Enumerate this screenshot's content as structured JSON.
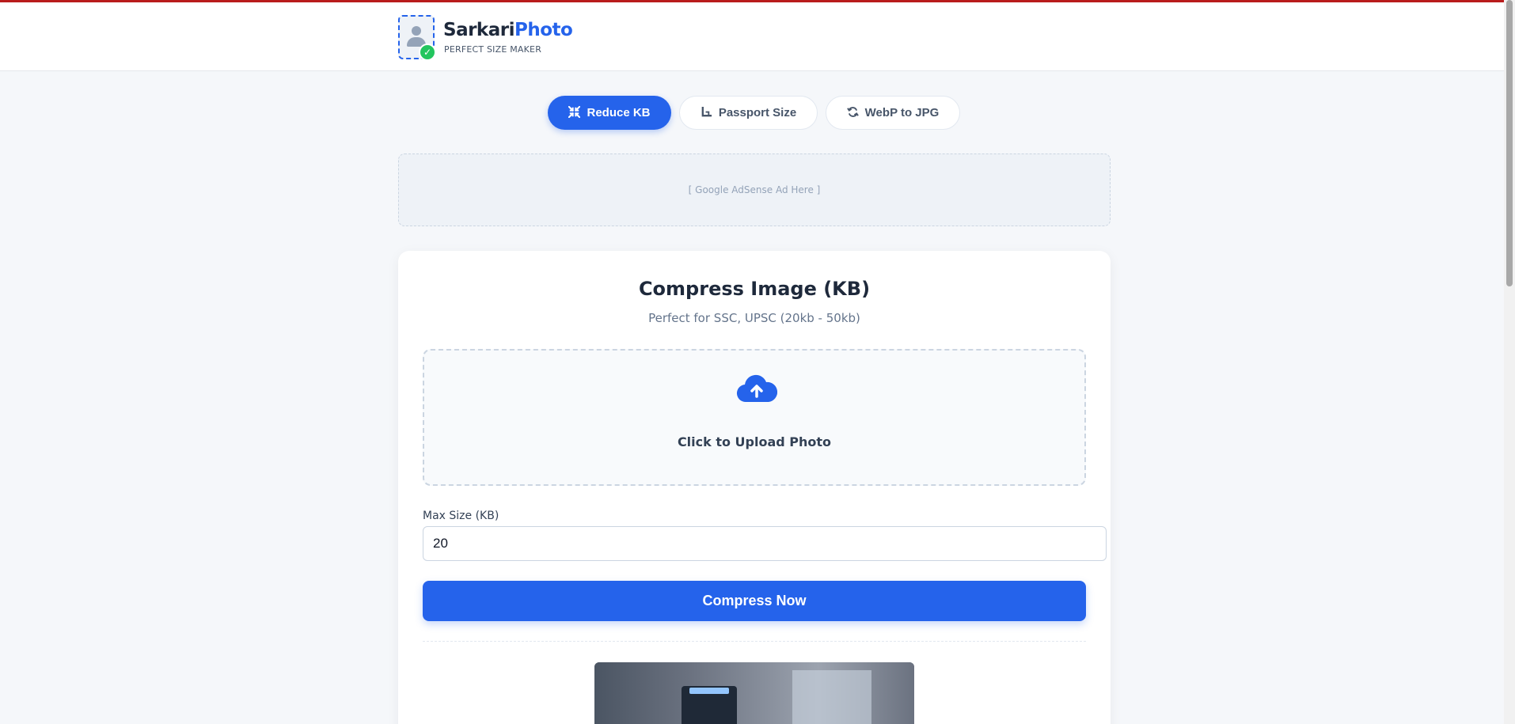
{
  "header": {
    "brand_part1": "Sarkari",
    "brand_part2": "Photo",
    "tagline": "PERFECT SIZE MAKER"
  },
  "tabs": [
    {
      "label": "Reduce KB",
      "icon": "compress-icon",
      "active": true
    },
    {
      "label": "Passport Size",
      "icon": "crop-icon",
      "active": false
    },
    {
      "label": "WebP to JPG",
      "icon": "sync-icon",
      "active": false
    }
  ],
  "ad": {
    "text": "[ Google AdSense Ad Here ]"
  },
  "card": {
    "title": "Compress Image (KB)",
    "subtitle": "Perfect for SSC, UPSC (20kb - 50kb)",
    "upload_label": "Click to Upload Photo",
    "upload_icon": "cloud-upload-icon",
    "max_size_label": "Max Size (KB)",
    "max_size_value": "20",
    "compress_button": "Compress Now"
  },
  "colors": {
    "accent": "#2563eb",
    "top_strip": "#b91c1c",
    "check": "#22c55e"
  }
}
